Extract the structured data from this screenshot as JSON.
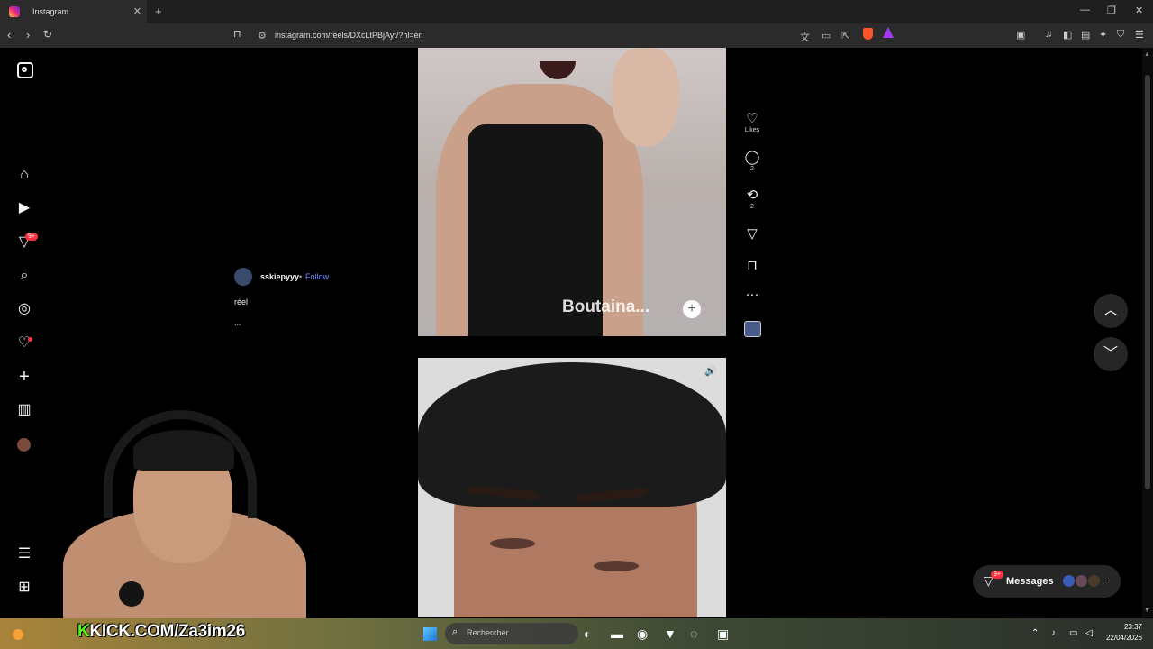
{
  "browser": {
    "tab_title": "Instagram",
    "url": "instagram.com/reels/DXcLtPBjAyt/?hl=en"
  },
  "sidebar": {
    "notifications_badge": "9+"
  },
  "reel": {
    "username": "sskiepyyy",
    "separator": "•",
    "follow_label": "Follow",
    "caption": "réel",
    "caption_extra": "...",
    "overlay_text": "Boutaina...",
    "likes_label": "Likes",
    "comments_count": "2",
    "reposts_count": "2"
  },
  "messages": {
    "label": "Messages",
    "badge": "9+"
  },
  "stream": {
    "overlay_prefix": "K",
    "overlay_text": "KICK.COM/Za3im26"
  },
  "taskbar": {
    "search_placeholder": "Rechercher",
    "time": "23:37",
    "date": "22/04/2026"
  },
  "colors": {
    "instagram_accent": "#ff3040",
    "follow_link": "#6a8dff",
    "kick_green": "#53fc18"
  }
}
